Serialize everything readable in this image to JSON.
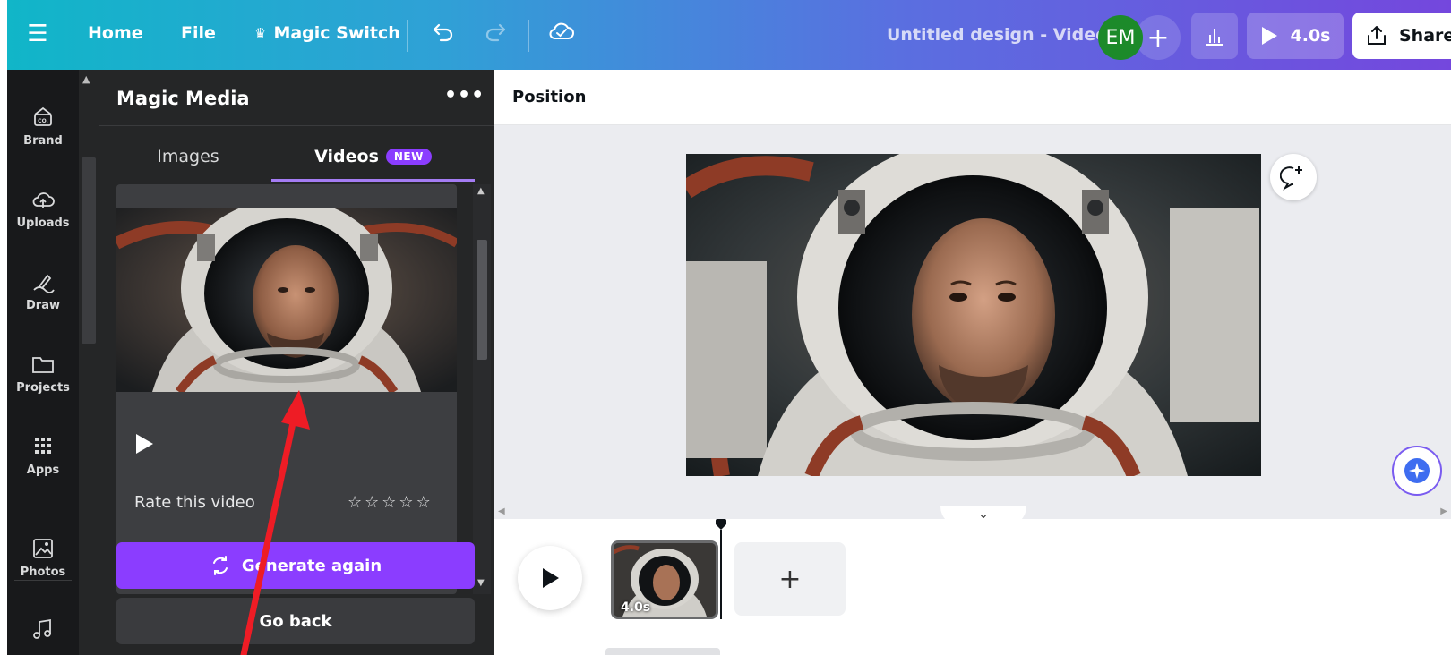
{
  "topbar": {
    "home": "Home",
    "file": "File",
    "magic_switch": "Magic Switch",
    "title": "Untitled design - Video",
    "avatar_initials": "EM",
    "play_duration": "4.0s",
    "share": "Share"
  },
  "rail": {
    "items": [
      {
        "label": "Brand",
        "icon": "brand-icon"
      },
      {
        "label": "Uploads",
        "icon": "upload-cloud-icon"
      },
      {
        "label": "Draw",
        "icon": "draw-icon"
      },
      {
        "label": "Projects",
        "icon": "folder-icon"
      },
      {
        "label": "Apps",
        "icon": "apps-grid-icon"
      },
      {
        "label": "Photos",
        "icon": "image-icon"
      }
    ]
  },
  "panel": {
    "title": "Magic Media",
    "tabs": [
      {
        "label": "Images",
        "active": false
      },
      {
        "label": "Videos",
        "active": true,
        "badge": "NEW"
      }
    ],
    "rate_label": "Rate this video",
    "rating_stars": 5,
    "generate_again": "Generate again",
    "go_back": "Go back"
  },
  "editor": {
    "position_label": "Position"
  },
  "timeline": {
    "clip_duration": "4.0s"
  },
  "colors": {
    "accent_purple": "#8b3dff",
    "dark_panel": "#252627",
    "annotation_arrow": "#ee1c25"
  }
}
